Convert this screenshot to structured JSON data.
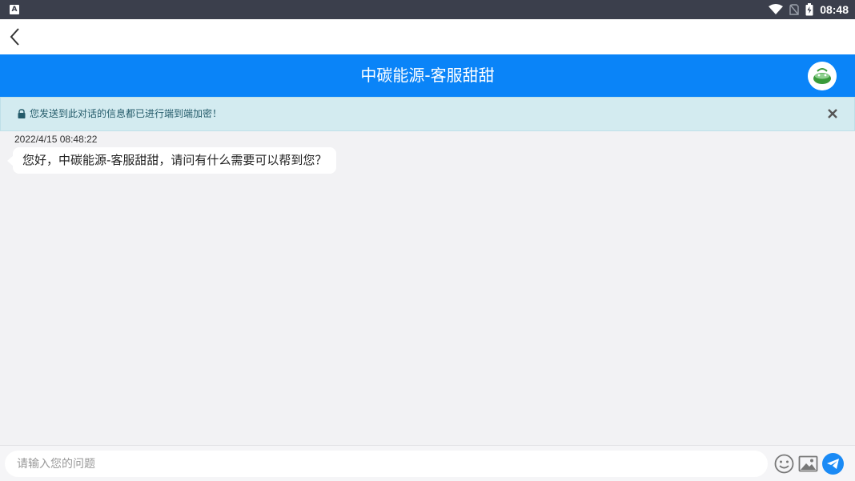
{
  "status_bar": {
    "time": "08:48"
  },
  "chat": {
    "title": "中碳能源-客服甜甜"
  },
  "notice": {
    "text": "您发送到此对话的信息都已进行端到端加密！"
  },
  "messages": [
    {
      "timestamp": "2022/4/15 08:48:22",
      "text": "您好，中碳能源-客服甜甜，请问有什么需要可以帮到您？"
    }
  ],
  "composer": {
    "placeholder": "请输入您的问题",
    "value": ""
  },
  "colors": {
    "header": "#0a84f8",
    "notice_bg": "#d3ebf0",
    "send": "#1a8af5"
  },
  "icons": [
    "back-arrow-icon",
    "avatar-logo",
    "lock-icon",
    "close-icon",
    "emoji-icon",
    "image-icon",
    "send-icon",
    "wifi-icon",
    "no-sim-icon",
    "battery-icon"
  ]
}
